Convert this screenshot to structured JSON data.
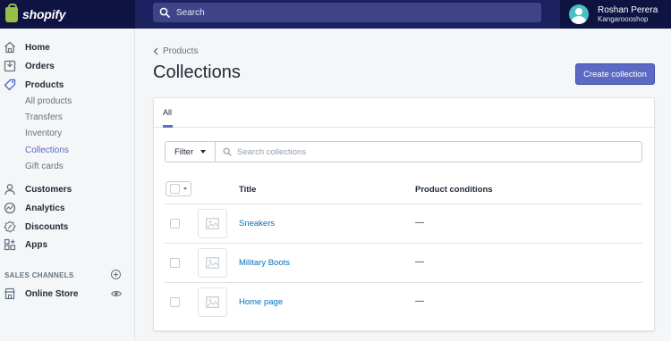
{
  "topbar": {
    "brand": "shopify",
    "search_placeholder": "Search",
    "user_name": "Roshan Perera",
    "shop_name": "Kangaroooshop"
  },
  "sidebar": {
    "items": [
      {
        "label": "Home",
        "icon": "home-icon"
      },
      {
        "label": "Orders",
        "icon": "orders-icon"
      },
      {
        "label": "Products",
        "icon": "tag-icon"
      }
    ],
    "product_subitems": [
      "All products",
      "Transfers",
      "Inventory",
      "Collections",
      "Gift cards"
    ],
    "active_subitem": "Collections",
    "items2": [
      {
        "label": "Customers",
        "icon": "person-icon"
      },
      {
        "label": "Analytics",
        "icon": "analytics-icon"
      },
      {
        "label": "Discounts",
        "icon": "discount-icon"
      },
      {
        "label": "Apps",
        "icon": "apps-icon"
      }
    ],
    "sales_channels_label": "SALES CHANNELS",
    "online_store_label": "Online Store"
  },
  "main": {
    "breadcrumb": "Products",
    "title": "Collections",
    "create_button": "Create collection",
    "tab_all": "All",
    "filter_label": "Filter",
    "search_placeholder": "Search collections",
    "col_title": "Title",
    "col_conditions": "Product conditions",
    "rows": [
      {
        "title": "Sneakers",
        "conditions": "—"
      },
      {
        "title": "Military Boots",
        "conditions": "—"
      },
      {
        "title": "Home page",
        "conditions": "—"
      }
    ]
  },
  "colors": {
    "topbar": "#1c2260",
    "accent": "#5c6ac4",
    "link": "#006fbb"
  }
}
